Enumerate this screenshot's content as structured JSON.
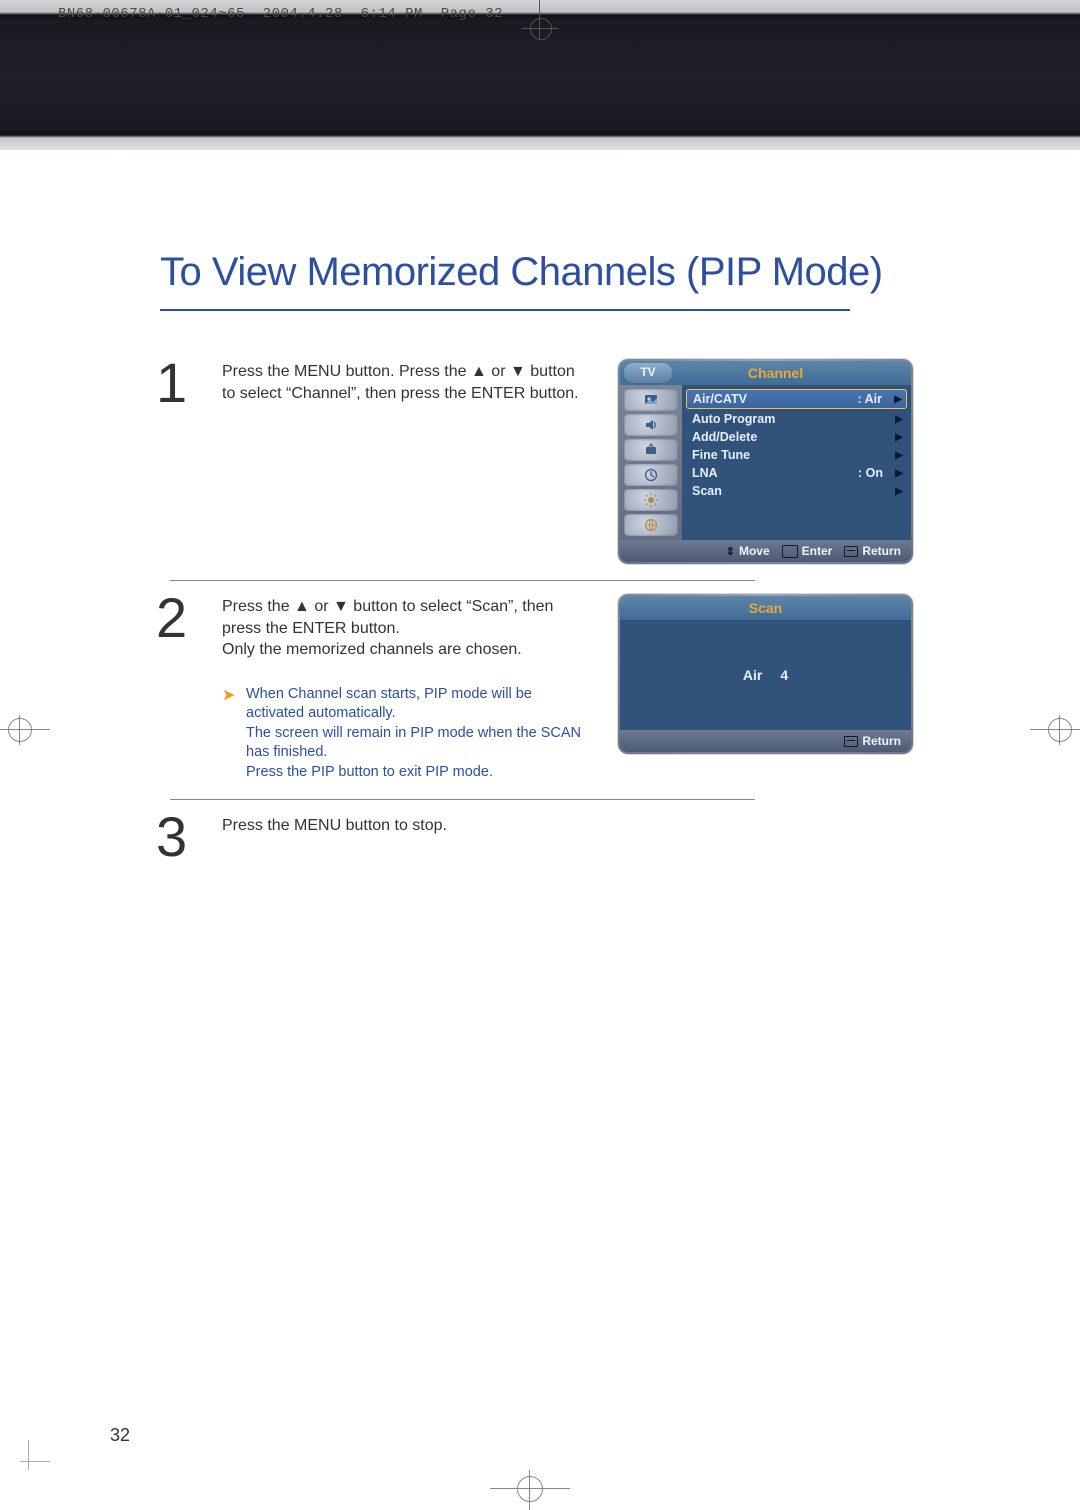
{
  "meta": {
    "print_line": "BN68-00678A-01_024~65  2004.4.28  6:14 PM  Page 32"
  },
  "title": "To View Memorized Channels (PIP Mode)",
  "page_number": "32",
  "steps": [
    {
      "pre": "Press the MENU button. Press the ",
      "mid": " or ",
      "post": " button to select “Channel”, then press the ENTER button."
    },
    {
      "pre": "Press the ",
      "mid": " or ",
      "post": " button to select “Scan”, then press the ENTER button.",
      "extra": "Only the memorized channels are chosen.",
      "note": [
        "When Channel scan starts, PIP mode will be activated automatically.",
        "The screen will remain in PIP mode when the SCAN has finished.",
        "Press the PIP button to exit PIP mode."
      ]
    },
    {
      "text": "Press the MENU button to stop."
    }
  ],
  "osd1": {
    "tv": "TV",
    "title": "Channel",
    "items": [
      {
        "label": "Air/CATV",
        "value": "Air"
      },
      {
        "label": "Auto Program"
      },
      {
        "label": "Add/Delete"
      },
      {
        "label": "Fine Tune"
      },
      {
        "label": "LNA",
        "value": "On"
      },
      {
        "label": "Scan"
      }
    ],
    "footer": [
      "Move",
      "Enter",
      "Return"
    ]
  },
  "osd2": {
    "title": "Scan",
    "source": "Air",
    "channel": "4",
    "footer": [
      "Return"
    ]
  }
}
